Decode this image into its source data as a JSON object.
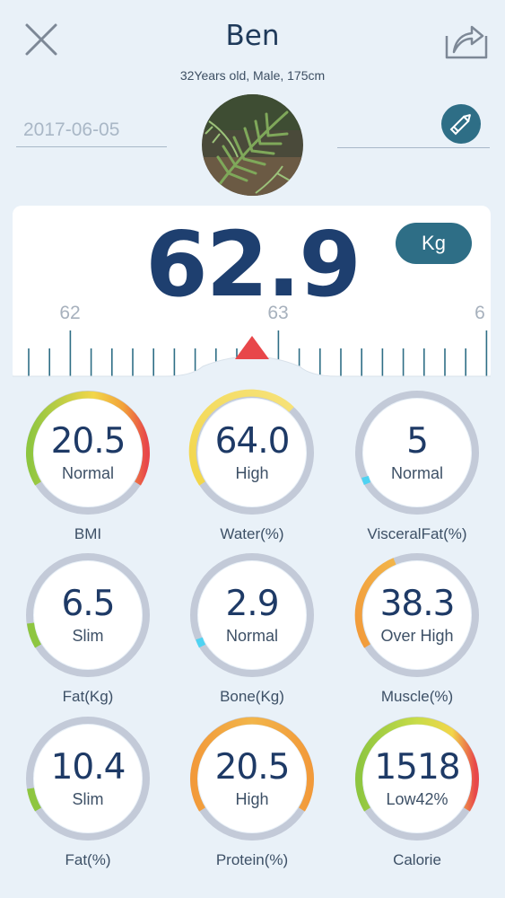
{
  "header": {
    "name": "Ben",
    "subtitle": "32Years old, Male, 175cm",
    "date": "2017-06-05"
  },
  "weight": {
    "value": "62.9",
    "unit": "Kg",
    "ruler_labels": [
      "62",
      "63",
      "6"
    ]
  },
  "metrics": [
    {
      "label": "BMI",
      "value": "20.5",
      "status": "Normal"
    },
    {
      "label": "Water(%)",
      "value": "64.0",
      "status": "High"
    },
    {
      "label": "VisceralFat(%)",
      "value": "5",
      "status": "Normal"
    },
    {
      "label": "Fat(Kg)",
      "value": "6.5",
      "status": "Slim"
    },
    {
      "label": "Bone(Kg)",
      "value": "2.9",
      "status": "Normal"
    },
    {
      "label": "Muscle(%)",
      "value": "38.3",
      "status": "Over High"
    },
    {
      "label": "Fat(%)",
      "value": "10.4",
      "status": "Slim"
    },
    {
      "label": "Protein(%)",
      "value": "20.5",
      "status": "High"
    },
    {
      "label": "Calorie",
      "value": "1518",
      "status": "Low42%"
    }
  ],
  "colors": {
    "accent": "#2e6e86",
    "title": "#1e3f6f",
    "track": "#c3cad8",
    "marker": "#e8474a"
  },
  "icons": {
    "close": "close-icon",
    "share": "share-icon",
    "edit": "pencil-icon"
  }
}
